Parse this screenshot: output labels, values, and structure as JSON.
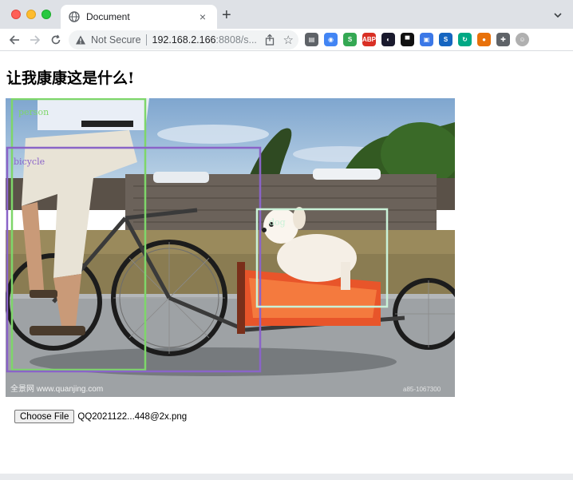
{
  "browser": {
    "tab": {
      "title": "Document",
      "close_glyph": "×"
    },
    "new_tab_glyph": "+",
    "omnibox": {
      "security_label": "Not Secure",
      "url_host": "192.168.2.166",
      "url_rest": ":8808/s..."
    },
    "extensions": [
      {
        "name": "reader-icon",
        "color": "#5f6368",
        "glyph": "▤"
      },
      {
        "name": "color-wheel-icon",
        "color": "#4285f4",
        "glyph": "◉"
      },
      {
        "name": "s-green-icon",
        "color": "#34a853",
        "glyph": "S"
      },
      {
        "name": "adblock-icon",
        "color": "#d93025",
        "glyph": "ABP"
      },
      {
        "name": "eye-icon",
        "color": "#1a1a2e",
        "glyph": "◐"
      },
      {
        "name": "mask-icon",
        "color": "#111111",
        "glyph": "▀"
      },
      {
        "name": "save-icon",
        "color": "#3b78e7",
        "glyph": "▣"
      },
      {
        "name": "s-blue-icon",
        "color": "#1565c0",
        "glyph": "S"
      },
      {
        "name": "refresh-green-icon",
        "color": "#00a884",
        "glyph": "↻"
      },
      {
        "name": "bell-icon",
        "color": "#e8710a",
        "glyph": "●"
      },
      {
        "name": "puzzle-icon",
        "color": "#5f6368",
        "glyph": "✚"
      },
      {
        "name": "profile-avatar-icon",
        "color": "#b0b0b0",
        "glyph": "☺"
      }
    ]
  },
  "page": {
    "heading": "让我康康这是什么!",
    "file_input": {
      "button_label": "Choose File",
      "file_name": "QQ2021122...448@2x.png"
    },
    "image": {
      "detections": [
        {
          "label": "person",
          "color": "#7ed66a"
        },
        {
          "label": "bicycle",
          "color": "#8a64c8"
        },
        {
          "label": "dog",
          "color": "#c9f2d8"
        }
      ],
      "watermark_left": "全景网 www.quanjing.com",
      "watermark_right": "a85-1067300"
    }
  },
  "colors": {
    "tabstrip": "#dee1e6",
    "accent": "#1a73e8"
  }
}
